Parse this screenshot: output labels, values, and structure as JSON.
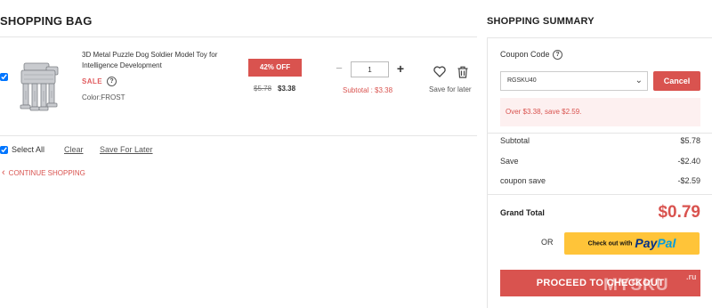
{
  "bag": {
    "title": "SHOPPING BAG",
    "item": {
      "title": "3D Metal Puzzle Dog Soldier Model Toy for Intelligence Development",
      "sale_label": "SALE",
      "color": "Color:FROST",
      "discount": "42% OFF",
      "old_price": "$5.78",
      "new_price": "$3.38",
      "quantity": "1",
      "subtotal": "Subtotal : $3.38",
      "save_later": "Save for later",
      "image_icon": "metal-walker-model-image"
    },
    "select_all": "Select All",
    "clear": "Clear",
    "save_for_later": "Save For Later",
    "continue": "CONTINUE SHOPPING"
  },
  "summary": {
    "title": "SHOPPING SUMMARY",
    "coupon_label": "Coupon Code",
    "coupon_value": "RGSKU40",
    "cancel": "Cancel",
    "coupon_message": "Over $3.38, save $2.59.",
    "rows": [
      {
        "label": "Subtotal",
        "value": "$5.78"
      },
      {
        "label": "Save",
        "value": "-$2.40"
      },
      {
        "label": "coupon save",
        "value": "-$2.59"
      }
    ],
    "grand_total_label": "Grand Total",
    "grand_total_value": "$0.79",
    "or": "OR",
    "paypal_text": "Check out with",
    "paypal_logo_a": "Pay",
    "paypal_logo_b": "Pal",
    "checkout": "PROCEED TO CHECKOUT"
  },
  "watermark": {
    "text": "MYSKU",
    "suffix": ".ru"
  },
  "colors": {
    "accent": "#d9534f",
    "paypal_yellow": "#ffc439",
    "paypal_blue": "#003087",
    "paypal_light_blue": "#009cde"
  }
}
